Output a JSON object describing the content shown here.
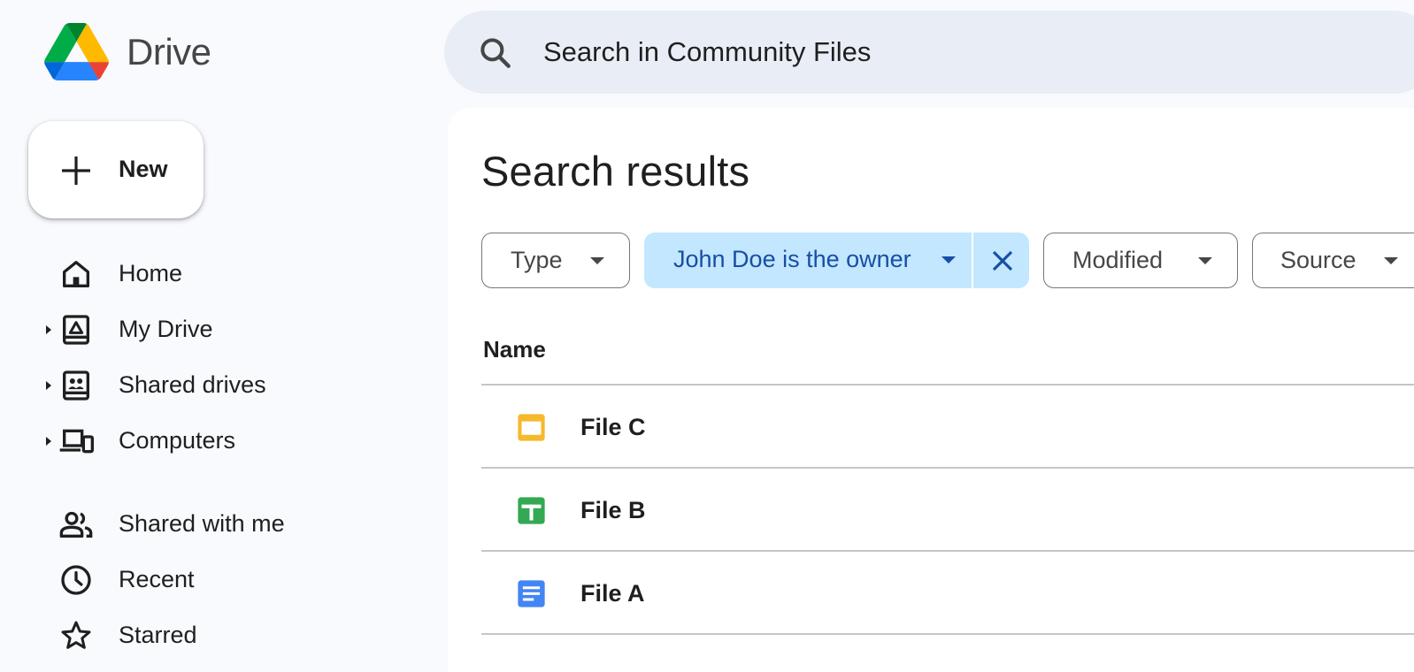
{
  "app": {
    "name": "Drive"
  },
  "search": {
    "placeholder": "Search in Community Files"
  },
  "new_button": {
    "label": "New"
  },
  "sidebar": {
    "items": [
      {
        "label": "Home",
        "icon": "home-icon",
        "expandable": false
      },
      {
        "label": "My Drive",
        "icon": "my-drive-icon",
        "expandable": true
      },
      {
        "label": "Shared drives",
        "icon": "shared-drives-icon",
        "expandable": true
      },
      {
        "label": "Computers",
        "icon": "computers-icon",
        "expandable": true
      },
      {
        "label": "Shared with me",
        "icon": "people-icon",
        "expandable": false
      },
      {
        "label": "Recent",
        "icon": "clock-icon",
        "expandable": false
      },
      {
        "label": "Starred",
        "icon": "star-icon",
        "expandable": false
      }
    ]
  },
  "main": {
    "title": "Search results",
    "filters": [
      {
        "label": "Type",
        "active": false
      },
      {
        "label": "John Doe is the owner",
        "active": true
      },
      {
        "label": "Modified",
        "active": false
      },
      {
        "label": "Source",
        "active": false
      }
    ],
    "columns": {
      "name": "Name"
    },
    "files": [
      {
        "name": "File C",
        "type": "slides",
        "icon": "slides-icon",
        "color": "#f6b92b"
      },
      {
        "name": "File B",
        "type": "sheets",
        "icon": "sheets-icon",
        "color": "#34a853"
      },
      {
        "name": "File A",
        "type": "docs",
        "icon": "docs-icon",
        "color": "#4285f4"
      }
    ]
  },
  "colors": {
    "background": "#f8fafd",
    "search_bg": "#e9eef6",
    "active_chip_bg": "#c2e7ff",
    "active_chip_text": "#174ea6",
    "border": "#747775"
  }
}
